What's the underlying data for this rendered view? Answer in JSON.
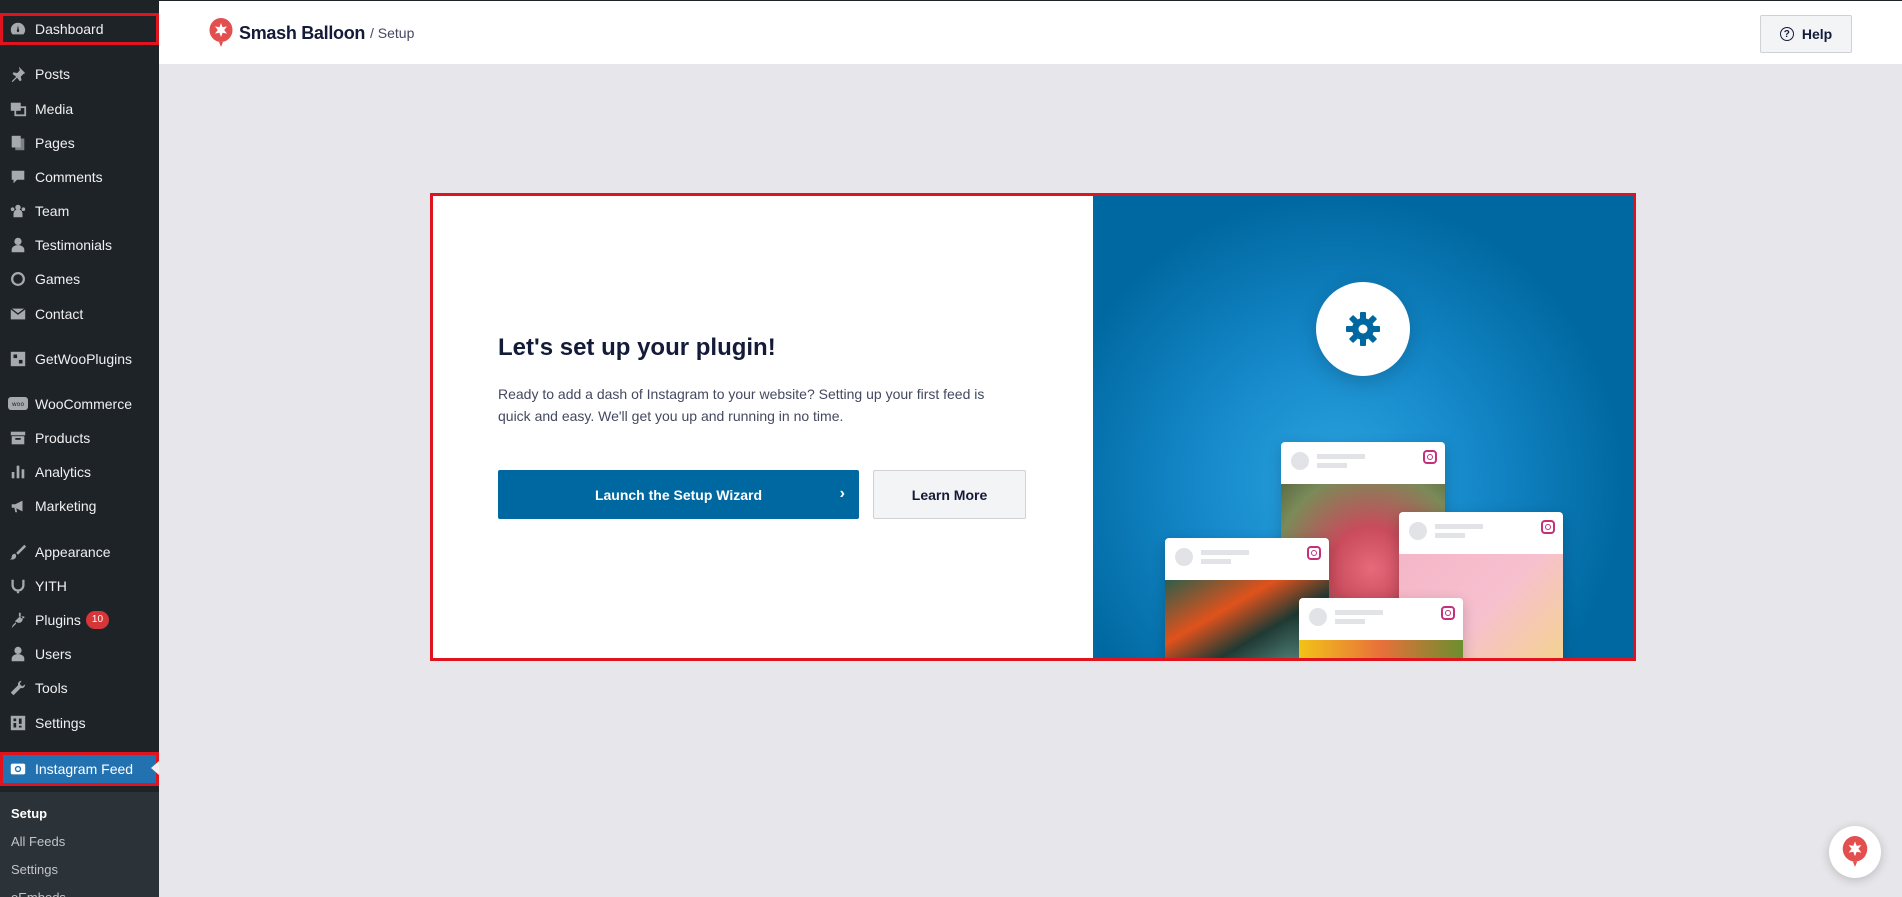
{
  "sidebar": {
    "items": [
      {
        "label": "Dashboard",
        "icon": "dashboard-icon"
      },
      {
        "label": "Posts",
        "icon": "pin-icon"
      },
      {
        "label": "Media",
        "icon": "media-icon"
      },
      {
        "label": "Pages",
        "icon": "pages-icon"
      },
      {
        "label": "Comments",
        "icon": "comment-icon"
      },
      {
        "label": "Team",
        "icon": "team-icon"
      },
      {
        "label": "Testimonials",
        "icon": "person-icon"
      },
      {
        "label": "Games",
        "icon": "circle-icon"
      },
      {
        "label": "Contact",
        "icon": "mail-icon"
      },
      {
        "label": "GetWooPlugins",
        "icon": "grid-icon"
      },
      {
        "label": "WooCommerce",
        "icon": "woo-icon"
      },
      {
        "label": "Products",
        "icon": "archive-icon"
      },
      {
        "label": "Analytics",
        "icon": "bar-chart-icon"
      },
      {
        "label": "Marketing",
        "icon": "megaphone-icon"
      },
      {
        "label": "Appearance",
        "icon": "brush-icon"
      },
      {
        "label": "YITH",
        "icon": "yith-icon"
      },
      {
        "label": "Plugins",
        "icon": "plug-icon",
        "badge": "10"
      },
      {
        "label": "Users",
        "icon": "user-icon"
      },
      {
        "label": "Tools",
        "icon": "wrench-icon"
      },
      {
        "label": "Settings",
        "icon": "settings-icon"
      },
      {
        "label": "Instagram Feed",
        "icon": "camera-icon"
      }
    ],
    "submenu": [
      "Setup",
      "All Feeds",
      "Settings",
      "oEmbeds"
    ]
  },
  "topbar": {
    "brand": "Smash Balloon",
    "breadcrumb": "/ Setup",
    "help_label": "Help"
  },
  "card": {
    "title": "Let's set up your plugin!",
    "description": "Ready to add a dash of Instagram to your website? Setting up your first feed is quick and easy. We'll get you up and running in no time.",
    "wizard_label": "Launch the Setup Wizard",
    "learn_label": "Learn More"
  },
  "colors": {
    "sidebar_bg": "#1d2327",
    "active_item": "#2271b1",
    "primary_button": "#0068a0",
    "highlight": "#e0141e",
    "brand_red": "#e34f4f"
  }
}
